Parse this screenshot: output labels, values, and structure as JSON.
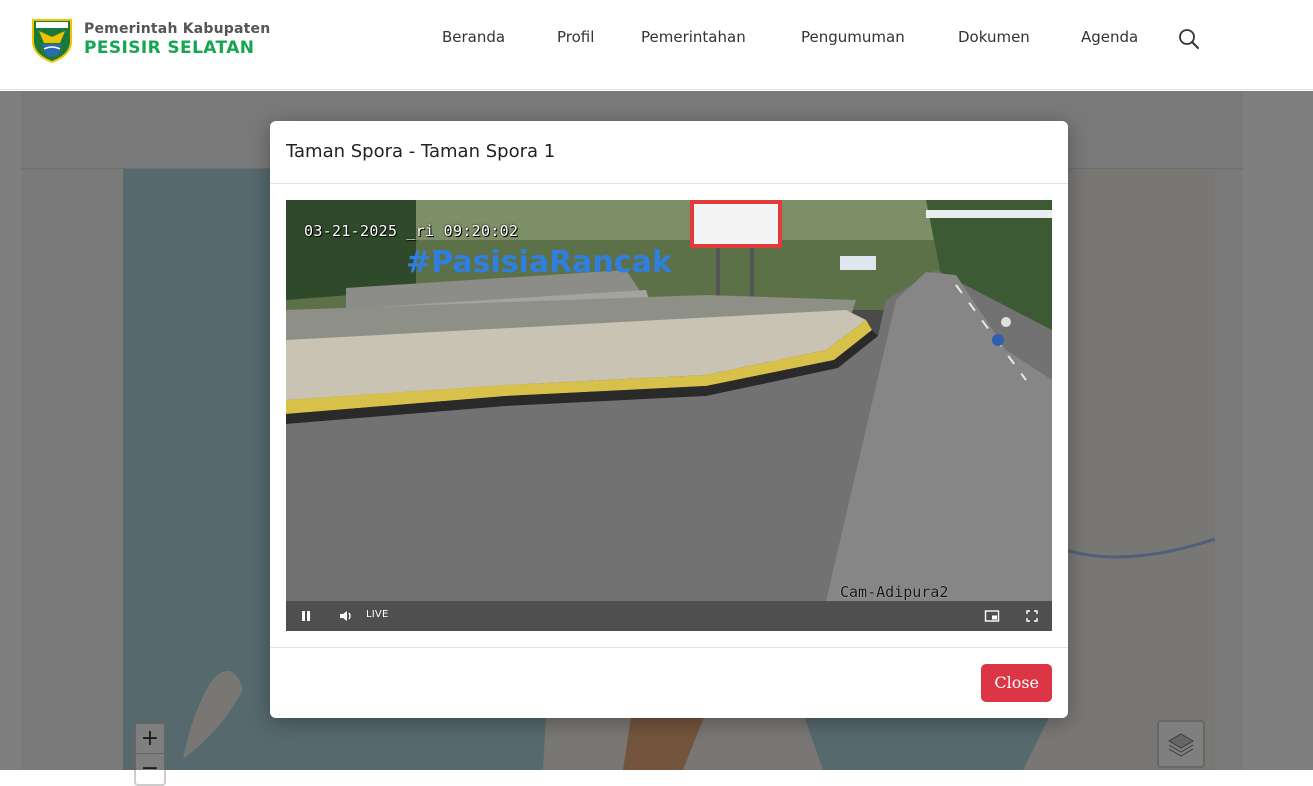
{
  "header": {
    "brand_line1": "Pemerintah Kabupaten",
    "brand_line2": "PESISIR SELATAN",
    "nav": [
      {
        "label": "Beranda"
      },
      {
        "label": "Profil"
      },
      {
        "label": "Pemerintahan"
      },
      {
        "label": "Pengumuman"
      },
      {
        "label": "Dokumen"
      },
      {
        "label": "Agenda"
      }
    ],
    "search_icon": "search-icon"
  },
  "map": {
    "zoom_in": "+",
    "zoom_out": "−",
    "layers_icon": "layers-icon"
  },
  "modal": {
    "title": "Taman Spora - Taman Spora 1",
    "close_label": "Close",
    "video": {
      "timestamp": "03-21-2025 Jumat 09:20:02",
      "timestamp_visible": "03-21-2025 ̲ri 09:20:02",
      "camera_name": "Cam-Adipura2",
      "sign_text": "#PasisiaRancak",
      "live_label": "LIVE",
      "state": "playing"
    }
  },
  "colors": {
    "brand_green": "#14a650",
    "close_button": "#dc3545",
    "map_water": "#aad3df"
  }
}
